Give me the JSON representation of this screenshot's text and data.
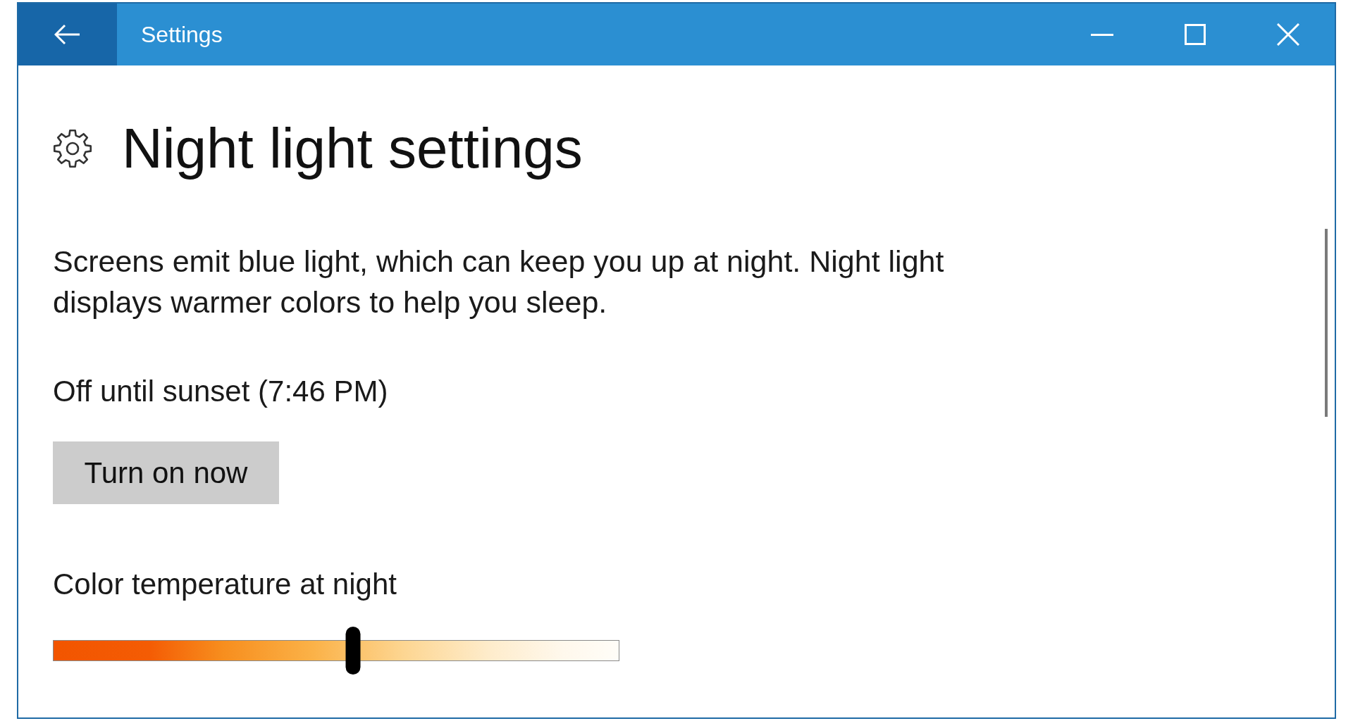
{
  "window": {
    "title": "Settings"
  },
  "header": {
    "title": "Night light settings"
  },
  "description": "Screens emit blue light, which can keep you up at night. Night light displays warmer colors to help you sleep.",
  "status": "Off until sunset (7:46 PM)",
  "turn_on_button": {
    "label": "Turn on now"
  },
  "color_temperature": {
    "label": "Color temperature at night",
    "level": 0.53
  }
}
